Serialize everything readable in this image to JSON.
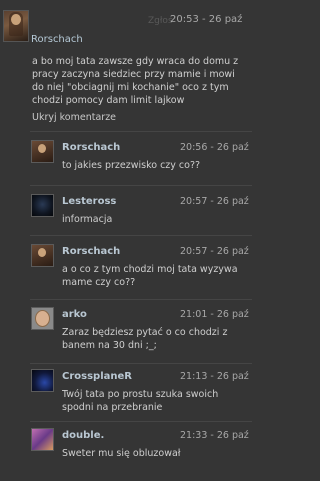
{
  "comment": {
    "report_label": "Zgłoś",
    "time": "20:53 - 26 paź",
    "author": "Rorschach",
    "text_lines": [
      "a bo moj tata zawsze gdy wraca do domu z",
      "pracy zaczyna siedziec przy mamie i mowi",
      "do niej \"obciagnij mi kochanie\" oco z tym",
      "chodzi pomocy dam limit lajkow"
    ],
    "hide_label": "Ukryj komentarze"
  },
  "replies": [
    {
      "author": "Rorschach",
      "time": "20:56 - 26 paź",
      "avatar_icon": "rorschach-avatar",
      "lines": [
        "to jakies przezwisko czy co??"
      ]
    },
    {
      "author": "Lesteross",
      "time": "20:57 - 26 paź",
      "avatar_icon": "lesteross-avatar",
      "lines": [
        "informacja"
      ]
    },
    {
      "author": "Rorschach",
      "time": "20:57 - 26 paź",
      "avatar_icon": "rorschach-avatar",
      "lines": [
        "a o co z tym chodzi moj tata wyzywa",
        "mame czy co??"
      ]
    },
    {
      "author": "arko",
      "time": "21:01 - 26 paź",
      "avatar_icon": "arko-avatar",
      "lines": [
        "Zaraz będziesz pytać o co chodzi z",
        "banem na 30 dni ;_;"
      ]
    },
    {
      "author": "CrossplaneR",
      "time": "21:13 - 26 paź",
      "avatar_icon": "crossplaner-avatar",
      "lines": [
        "Twój tata po prostu szuka swoich",
        "spodni na przebranie"
      ]
    },
    {
      "author": "double.",
      "time": "21:33 - 26 paź",
      "avatar_icon": "double-avatar",
      "lines": [
        "Sweter mu się obluzował"
      ]
    }
  ]
}
